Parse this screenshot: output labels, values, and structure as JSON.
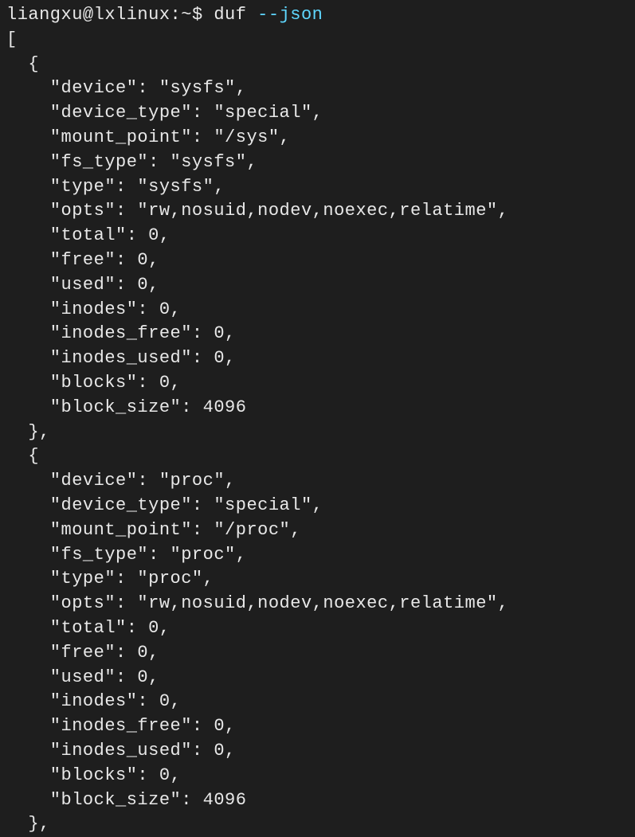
{
  "prompt": {
    "user_host": "liangxu@lxlinux",
    "path": "~",
    "symbol": "$",
    "command": "duf",
    "flag": "--json"
  },
  "json_output": {
    "open_bracket": "[",
    "entries": [
      {
        "open_brace": "  {",
        "lines": [
          "    \"device\": \"sysfs\",",
          "    \"device_type\": \"special\",",
          "    \"mount_point\": \"/sys\",",
          "    \"fs_type\": \"sysfs\",",
          "    \"type\": \"sysfs\",",
          "    \"opts\": \"rw,nosuid,nodev,noexec,relatime\",",
          "    \"total\": 0,",
          "    \"free\": 0,",
          "    \"used\": 0,",
          "    \"inodes\": 0,",
          "    \"inodes_free\": 0,",
          "    \"inodes_used\": 0,",
          "    \"blocks\": 0,",
          "    \"block_size\": 4096"
        ],
        "close_brace": "  },"
      },
      {
        "open_brace": "  {",
        "lines": [
          "    \"device\": \"proc\",",
          "    \"device_type\": \"special\",",
          "    \"mount_point\": \"/proc\",",
          "    \"fs_type\": \"proc\",",
          "    \"type\": \"proc\",",
          "    \"opts\": \"rw,nosuid,nodev,noexec,relatime\",",
          "    \"total\": 0,",
          "    \"free\": 0,",
          "    \"used\": 0,",
          "    \"inodes\": 0,",
          "    \"inodes_free\": 0,",
          "    \"inodes_used\": 0,",
          "    \"blocks\": 0,",
          "    \"block_size\": 4096"
        ],
        "close_brace": "  },"
      }
    ]
  }
}
